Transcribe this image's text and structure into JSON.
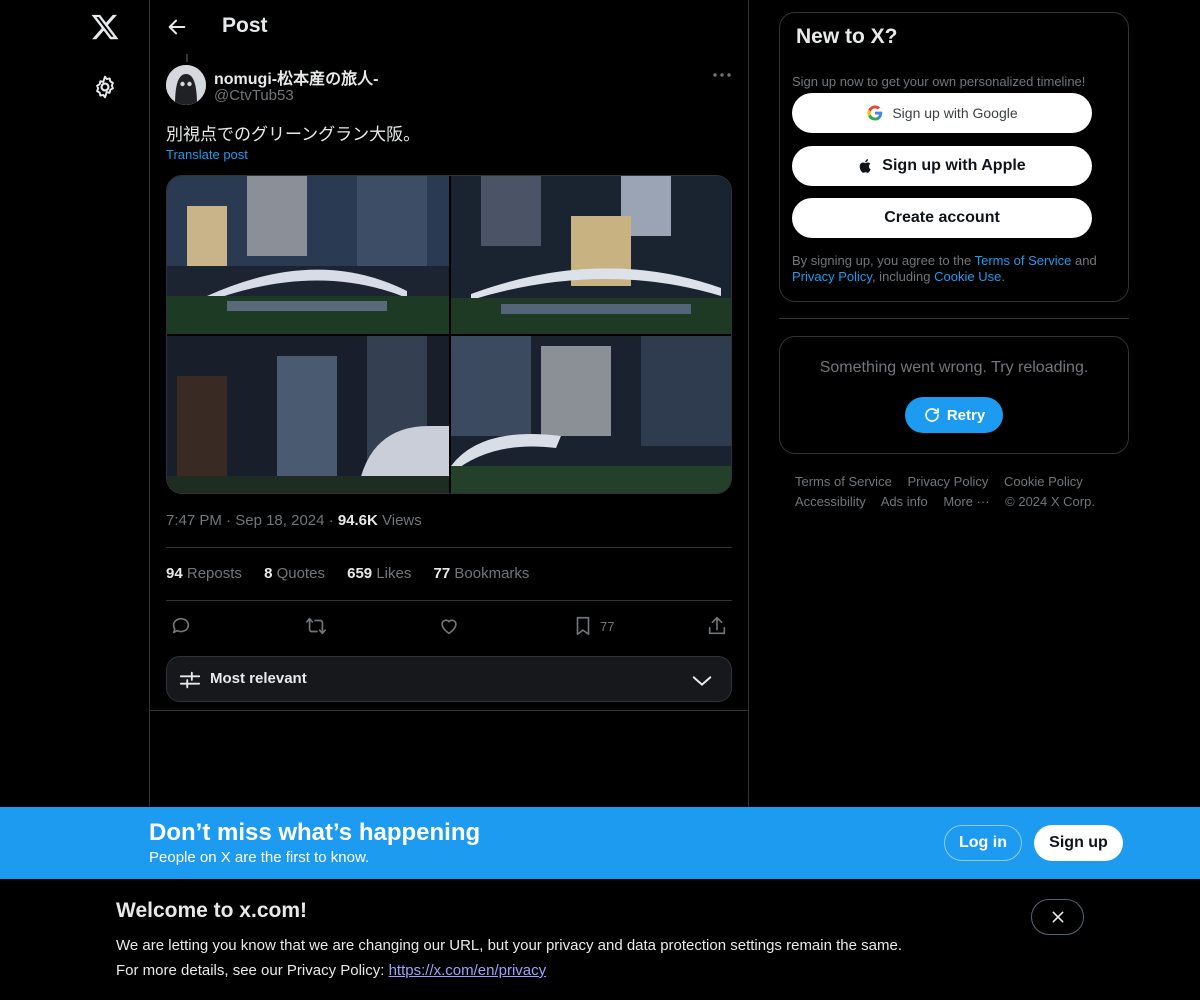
{
  "nav": {
    "logo_icon": "x-logo-icon",
    "settings_icon": "gear-icon"
  },
  "header": {
    "title": "Post"
  },
  "post": {
    "author_name": "nomugi-松本産の旅人-",
    "author_handle": "@CtvTub53",
    "text": "別視点でのグリーングラン大阪。",
    "translate": "Translate post",
    "time": "7:47 PM",
    "date": "Sep 18, 2024",
    "views_count": "94.6K",
    "views_label": "Views",
    "stats": {
      "reposts_count": "94",
      "reposts_label": "Reposts",
      "quotes_count": "8",
      "quotes_label": "Quotes",
      "likes_count": "659",
      "likes_label": "Likes",
      "bookmarks_count": "77",
      "bookmarks_label": "Bookmarks"
    },
    "actions": {
      "bookmark_count": "77"
    },
    "sort_label": "Most relevant"
  },
  "sidebar": {
    "signup": {
      "title": "New to X?",
      "subtitle": "Sign up now to get your own personalized timeline!",
      "google_label": "Sign up with Google",
      "apple_label": "Sign up with Apple",
      "create_label": "Create account",
      "legal_pre": "By signing up, you agree to the ",
      "terms": "Terms of Service",
      "and": " and ",
      "privacy": "Privacy Policy",
      "including": ", including ",
      "cookie": "Cookie Use",
      "period": "."
    },
    "error": {
      "text": "Something went wrong. Try reloading.",
      "retry_label": "Retry"
    },
    "footer": {
      "terms": "Terms of Service",
      "privacy": "Privacy Policy",
      "cookie": "Cookie Policy",
      "accessibility": "Accessibility",
      "ads": "Ads info",
      "more": "More ···",
      "copyright": "© 2024 X Corp."
    }
  },
  "banner": {
    "title": "Don’t miss what’s happening",
    "subtitle": "People on X are the first to know.",
    "login_label": "Log in",
    "signup_label": "Sign up"
  },
  "welcome": {
    "title": "Welcome to x.com!",
    "line1": "We are letting you know that we are changing our URL, but your privacy and data protection settings remain the same.",
    "line2_pre": "For more details, see our Privacy Policy: ",
    "link": "https://x.com/en/privacy"
  },
  "colors": {
    "accent": "#1d9bf0",
    "background": "#000000",
    "border": "#2f3336",
    "muted": "#71767b"
  }
}
